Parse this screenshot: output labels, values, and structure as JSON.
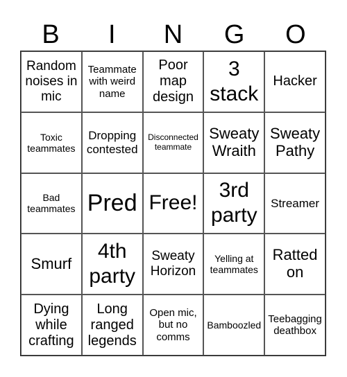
{
  "header": [
    "B",
    "I",
    "N",
    "G",
    "O"
  ],
  "cells": [
    [
      "Random noises in mic",
      "Teammate with weird name",
      "Poor map design",
      "3 stack",
      "Hacker"
    ],
    [
      "Toxic teammates",
      "Dropping contested",
      "Disconnected teammate",
      "Sweaty Wraith",
      "Sweaty Pathy"
    ],
    [
      "Bad teammates",
      "Pred",
      "Free!",
      "3rd party",
      "Streamer"
    ],
    [
      "Smurf",
      "4th party",
      "Sweaty Horizon",
      "Yelling at teammates",
      "Ratted on"
    ],
    [
      "Dying while crafting",
      "Long ranged legends",
      "Open mic, but no comms",
      "Bamboozled",
      "Teebagging deathbox"
    ]
  ]
}
